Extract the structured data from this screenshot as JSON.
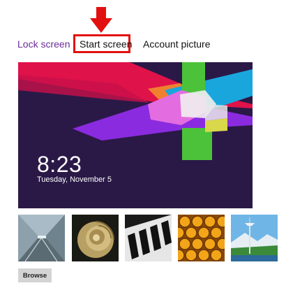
{
  "tabs": [
    {
      "label": "Lock screen"
    },
    {
      "label": "Start screen"
    },
    {
      "label": "Account picture"
    }
  ],
  "colors": {
    "accent_purple": "#6b2b99",
    "highlight_red": "#e21010",
    "preview_bg": "#2a1947"
  },
  "preview": {
    "time": "8:23",
    "date": "Tuesday, November 5"
  },
  "thumbnails": [
    {
      "name": "tunnel-thumbnail"
    },
    {
      "name": "nautilus-shell-thumbnail"
    },
    {
      "name": "piano-keys-thumbnail"
    },
    {
      "name": "honeycomb-thumbnail"
    },
    {
      "name": "space-needle-thumbnail"
    }
  ],
  "browse_label": "Browse"
}
